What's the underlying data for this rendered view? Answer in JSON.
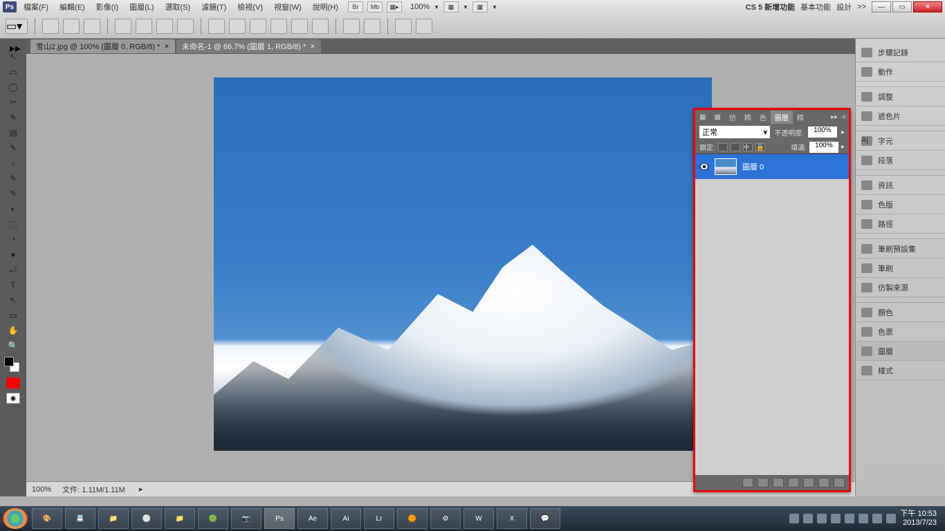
{
  "menubar": {
    "logo": "Ps",
    "items": [
      "檔案(F)",
      "編輯(E)",
      "影像(I)",
      "圖層(L)",
      "選取(S)",
      "濾鏡(T)",
      "檢視(V)",
      "視窗(W)",
      "說明(H)"
    ],
    "top_icons": [
      "Br",
      "Mb",
      "▦▸"
    ],
    "zoom": "100%",
    "workspace_links": [
      "CS 5 新增功能",
      "基本功能",
      "設計",
      ">>"
    ]
  },
  "doc_tabs": [
    {
      "label": "雪山2.jpg @ 100% (圖層 0, RGB/8) *",
      "active": true
    },
    {
      "label": "未命名-1 @ 66.7% (圖層 1, RGB/8) *",
      "active": false
    }
  ],
  "layers_panel": {
    "tabs": [
      "▦",
      "▦",
      "仿",
      "精",
      "色",
      "圖層",
      "精"
    ],
    "active_tab": "圖層",
    "blend_mode": "正常",
    "opacity_label": "不透明度:",
    "opacity": "100%",
    "lock_label": "鎖定:",
    "fill_label": "填滿:",
    "fill": "100%",
    "layer": {
      "name": "圖層 0"
    }
  },
  "right_strip": {
    "groups": [
      [
        "步驟記錄",
        "動作"
      ],
      [
        "調整",
        "遮色片"
      ],
      [
        "字元",
        "段落"
      ],
      [
        "資訊",
        "色版",
        "路徑"
      ],
      [
        "筆刷預設集",
        "筆刷",
        "仿製來源"
      ],
      [
        "顏色",
        "色票",
        "圖層",
        "樣式"
      ]
    ],
    "selected": "圖層"
  },
  "status_bar": {
    "zoom": "100%",
    "doc_label": "文件:",
    "doc_size": "1.11M/1.11M"
  },
  "taskbar": {
    "items": [
      "🎨",
      "📇",
      "📁",
      "⚪",
      "📁",
      "🟢",
      "📷",
      "Ps",
      "Ae",
      "Ai",
      "Lr",
      "🟠",
      "⚙",
      "W",
      "X",
      "💬"
    ],
    "active_index": 7,
    "clock_time": "下午 10:53",
    "clock_date": "2013/7/23"
  },
  "tools": [
    "↖",
    "▭",
    "◯",
    "✂",
    "✎",
    "▤",
    "✎",
    "⌕",
    "✎",
    "✎",
    "◐",
    "⬚",
    "◔",
    "●",
    "⤾",
    "✎",
    "T",
    "↖",
    "▭",
    "✋",
    "🔍"
  ]
}
